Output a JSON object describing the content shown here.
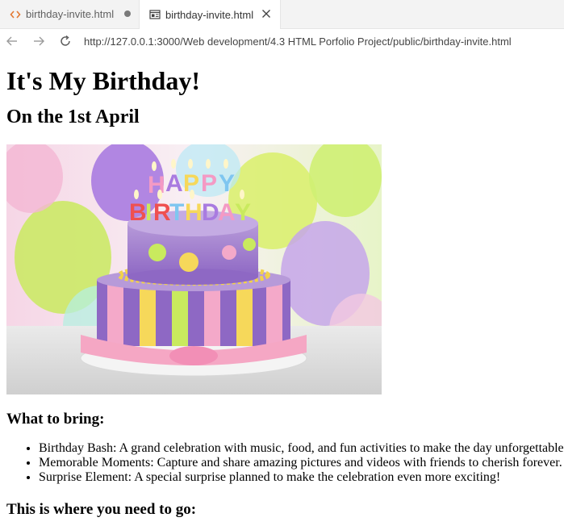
{
  "tabs": [
    {
      "label": "birthday-invite.html",
      "icon": "code-icon",
      "state": "modified"
    },
    {
      "label": "birthday-invite.html",
      "icon": "preview-icon",
      "state": "active"
    }
  ],
  "address_bar": {
    "url": "http://127.0.0.1:3000/Web development/4.3 HTML Porfolio Project/public/birthday-invite.html"
  },
  "page": {
    "title": "It's My Birthday!",
    "date": "On the 1st April",
    "image_alt_letters": "HAPPY BIRTHDAY",
    "bring_heading": "What to bring:",
    "bring_items": [
      "Birthday Bash: A grand celebration with music, food, and fun activities to make the day unforgettable.",
      "Memorable Moments: Capture and share amazing pictures and videos with friends to cherish forever.",
      "Surprise Element: A special surprise planned to make the celebration even more exciting!"
    ],
    "location_heading": "This is where you need to go:"
  },
  "colors": {
    "tab_modified_dot": "#7a7a7a",
    "active_tab_bg": "#ffffff",
    "tabbar_bg": "#f3f3f3"
  }
}
